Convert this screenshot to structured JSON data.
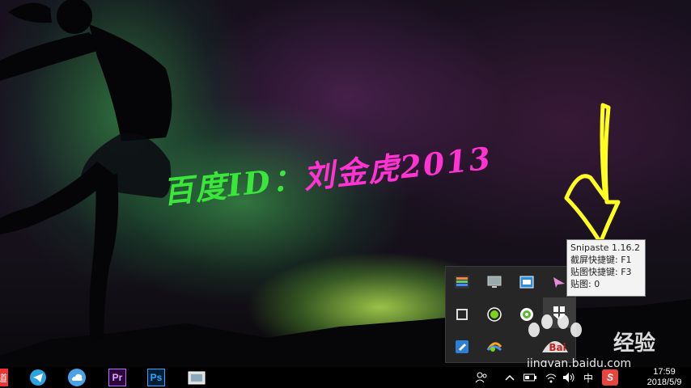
{
  "watermark": {
    "prefix": "百度ID：",
    "name": "刘金虎2013"
  },
  "tray_popup": {
    "icons": [
      "color-grid-icon",
      "monitor-icon",
      "window-capture-icon",
      "paper-plane-icon",
      "stop-square-icon",
      "record-circle-icon",
      "refresh-circle-icon",
      "snipaste-icon",
      "edit-app-icon",
      "colorful-arc-icon"
    ]
  },
  "tooltip": {
    "title": "Snipaste 1.16.2",
    "line1": "截屏快捷键: F1",
    "line2": "贴图快捷键: F3",
    "line3": "贴图: 0"
  },
  "baidu_watermark": {
    "text": "经验",
    "url": "jingyan.baidu.com",
    "logo": "Bai"
  },
  "taskbar": {
    "apps": [
      {
        "name": "youdao-icon",
        "label": "道"
      },
      {
        "name": "telegram-icon",
        "label": ""
      },
      {
        "name": "cloud-icon",
        "label": ""
      },
      {
        "name": "premiere-icon",
        "label": "Pr"
      },
      {
        "name": "photoshop-icon",
        "label": "Ps"
      },
      {
        "name": "screenshot-app-icon",
        "label": ""
      }
    ],
    "ime": "中",
    "sogou": "S",
    "time": "17:59",
    "date": "2018/5/9"
  },
  "colors": {
    "accent_green": "#39e639",
    "accent_pink": "#ff33d1",
    "arrow_yellow": "#ffff22"
  }
}
